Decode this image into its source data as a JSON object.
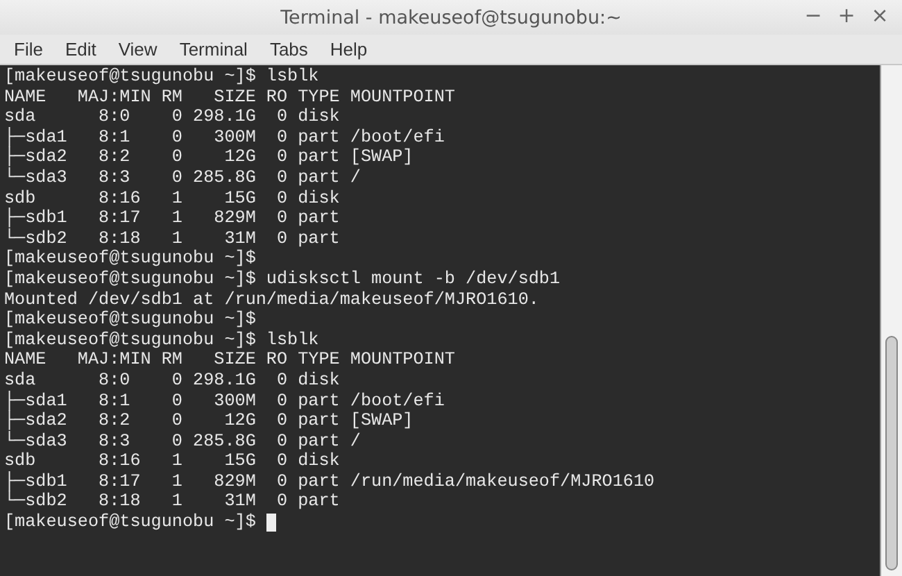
{
  "window": {
    "title": "Terminal - makeuseof@tsugunobu:~",
    "controls": [
      "−",
      "+",
      "×"
    ]
  },
  "menu": [
    "File",
    "Edit",
    "View",
    "Terminal",
    "Tabs",
    "Help"
  ],
  "terminal": {
    "lines": [
      "[makeuseof@tsugunobu ~]$ lsblk",
      "NAME   MAJ:MIN RM   SIZE RO TYPE MOUNTPOINT",
      "sda      8:0    0 298.1G  0 disk",
      "├─sda1   8:1    0   300M  0 part /boot/efi",
      "├─sda2   8:2    0    12G  0 part [SWAP]",
      "└─sda3   8:3    0 285.8G  0 part /",
      "sdb      8:16   1    15G  0 disk",
      "├─sdb1   8:17   1   829M  0 part",
      "└─sdb2   8:18   1    31M  0 part",
      "[makeuseof@tsugunobu ~]$",
      "[makeuseof@tsugunobu ~]$ udisksctl mount -b /dev/sdb1",
      "Mounted /dev/sdb1 at /run/media/makeuseof/MJRO1610.",
      "[makeuseof@tsugunobu ~]$",
      "[makeuseof@tsugunobu ~]$ lsblk",
      "NAME   MAJ:MIN RM   SIZE RO TYPE MOUNTPOINT",
      "sda      8:0    0 298.1G  0 disk",
      "├─sda1   8:1    0   300M  0 part /boot/efi",
      "├─sda2   8:2    0    12G  0 part [SWAP]",
      "└─sda3   8:3    0 285.8G  0 part /",
      "sdb      8:16   1    15G  0 disk",
      "├─sdb1   8:17   1   829M  0 part /run/media/makeuseof/MJRO1610",
      "└─sdb2   8:18   1    31M  0 part",
      "[makeuseof@tsugunobu ~]$ "
    ],
    "cursor": true
  }
}
